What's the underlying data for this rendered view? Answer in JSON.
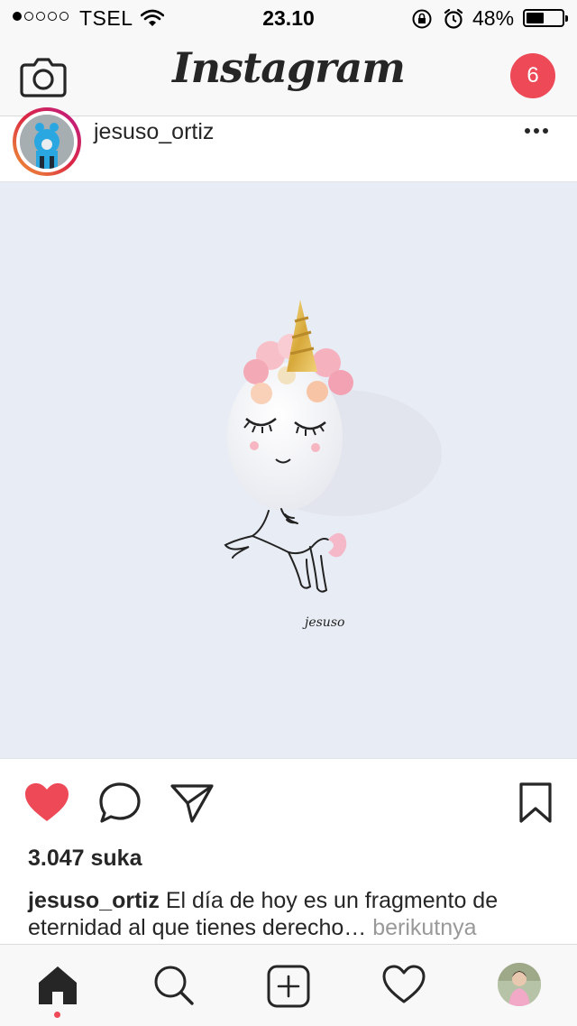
{
  "status_bar": {
    "carrier": "TSEL",
    "time": "23.10",
    "battery_percent": "48%",
    "battery_level": 0.48,
    "signal_bars_filled": 1,
    "signal_bars_total": 5
  },
  "header": {
    "logo_text": "Instagram",
    "notification_count": "6",
    "badge_color": "#ed4956"
  },
  "post": {
    "username": "jesuso_ortiz",
    "image_signature": "jesuso",
    "likes_text": "3.047 suka",
    "caption_username": "jesuso_ortiz",
    "caption_text": " El día de hoy es un fragmento de eternidad al que tienes derecho…",
    "caption_more": " berikutnya",
    "liked": true,
    "like_color": "#ed4956"
  },
  "tab_bar": {
    "items": [
      "home-icon",
      "search-icon",
      "new-post-icon",
      "heart-icon",
      "profile-avatar"
    ],
    "active": "home-icon"
  }
}
